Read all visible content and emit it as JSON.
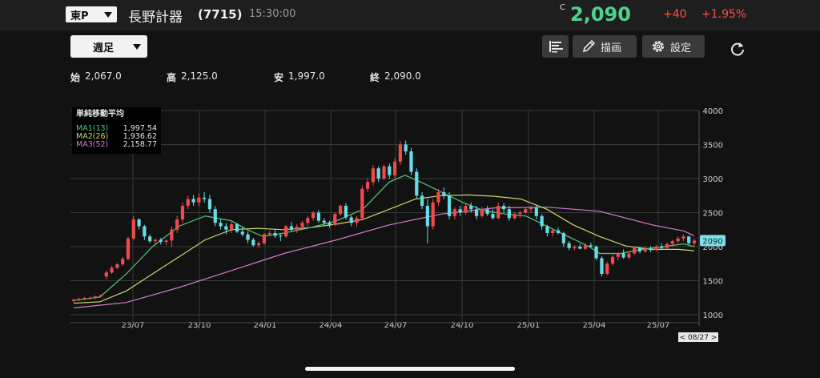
{
  "header": {
    "market": "東P",
    "name": "長野計器",
    "code": "(7715)",
    "time": "15:30:00",
    "close_mark": "C",
    "price": "2,090",
    "change": "+40",
    "change_pct": "+1.95%"
  },
  "toolbar": {
    "period": "週足",
    "draw_label": "描画",
    "settings_label": "設定"
  },
  "ohlc": {
    "open_label": "始",
    "open": "2,067.0",
    "high_label": "高",
    "high": "2,125.0",
    "low_label": "安",
    "low": "1,997.0",
    "close_label": "終",
    "close": "2,090.0"
  },
  "colors": {
    "up": "#f04b4b",
    "down": "#66dde6",
    "ma1": "#4ec97f",
    "ma2": "#c9d86a",
    "ma3": "#d77ad0",
    "price_up_text": "#4fd38a",
    "change_text": "#ff4d4d"
  },
  "chart_data": {
    "type": "candlestick",
    "legend_title": "単純移動平均",
    "legend": [
      {
        "name": "MA1(13)",
        "value": "1,997.54",
        "color": "#4ec97f"
      },
      {
        "name": "MA2(26)",
        "value": "1,936.62",
        "color": "#c9d86a"
      },
      {
        "name": "MA3(52)",
        "value": "2,158.77",
        "color": "#d77ad0"
      }
    ],
    "legend_placement": "top-left",
    "y_ticks": [
      1000,
      1500,
      2000,
      2500,
      3000,
      3500,
      4000
    ],
    "ylim": [
      900,
      4000
    ],
    "x_ticks": [
      "23/07",
      "23/10",
      "24/01",
      "24/04",
      "24/07",
      "24/10",
      "25/01",
      "25/04",
      "25/07"
    ],
    "grid": true,
    "last_price_label": "2090",
    "cursor_label": "< 08/27 >",
    "candles": [
      [
        1200,
        1240,
        1180,
        1220
      ],
      [
        1220,
        1250,
        1200,
        1235
      ],
      [
        1235,
        1260,
        1210,
        1245
      ],
      [
        1245,
        1270,
        1220,
        1250
      ],
      [
        1250,
        1280,
        1230,
        1270
      ],
      [
        1270,
        1300,
        1250,
        1285
      ],
      [
        1560,
        1650,
        1520,
        1620
      ],
      [
        1620,
        1720,
        1600,
        1690
      ],
      [
        1690,
        1760,
        1670,
        1740
      ],
      [
        1740,
        1850,
        1720,
        1820
      ],
      [
        1820,
        2150,
        1800,
        2120
      ],
      [
        2120,
        2450,
        2100,
        2400
      ],
      [
        2400,
        2420,
        2250,
        2300
      ],
      [
        2300,
        2320,
        2100,
        2150
      ],
      [
        2150,
        2180,
        2050,
        2080
      ],
      [
        2080,
        2120,
        2020,
        2100
      ],
      [
        2100,
        2130,
        2030,
        2070
      ],
      [
        2070,
        2110,
        2020,
        2090
      ],
      [
        2090,
        2300,
        2000,
        2250
      ],
      [
        2250,
        2450,
        2200,
        2400
      ],
      [
        2400,
        2650,
        2350,
        2600
      ],
      [
        2600,
        2750,
        2550,
        2700
      ],
      [
        2700,
        2760,
        2600,
        2650
      ],
      [
        2650,
        2780,
        2600,
        2720
      ],
      [
        2720,
        2800,
        2650,
        2700
      ],
      [
        2700,
        2760,
        2500,
        2550
      ],
      [
        2550,
        2600,
        2300,
        2350
      ],
      [
        2350,
        2400,
        2250,
        2300
      ],
      [
        2300,
        2350,
        2180,
        2250
      ],
      [
        2250,
        2380,
        2200,
        2330
      ],
      [
        2330,
        2350,
        2200,
        2220
      ],
      [
        2220,
        2280,
        2150,
        2180
      ],
      [
        2180,
        2220,
        2050,
        2100
      ],
      [
        2100,
        2130,
        2000,
        2020
      ],
      [
        2020,
        2080,
        1980,
        2050
      ],
      [
        2050,
        2200,
        2030,
        2180
      ],
      [
        2180,
        2230,
        2150,
        2200
      ],
      [
        2200,
        2250,
        2130,
        2160
      ],
      [
        2160,
        2200,
        2080,
        2150
      ],
      [
        2150,
        2320,
        2130,
        2300
      ],
      [
        2300,
        2360,
        2220,
        2250
      ],
      [
        2250,
        2330,
        2200,
        2290
      ],
      [
        2290,
        2380,
        2250,
        2350
      ],
      [
        2350,
        2450,
        2300,
        2420
      ],
      [
        2420,
        2520,
        2380,
        2500
      ],
      [
        2500,
        2540,
        2350,
        2380
      ],
      [
        2380,
        2420,
        2300,
        2350
      ],
      [
        2350,
        2380,
        2280,
        2320
      ],
      [
        2320,
        2500,
        2300,
        2480
      ],
      [
        2480,
        2620,
        2450,
        2600
      ],
      [
        2600,
        2640,
        2400,
        2430
      ],
      [
        2430,
        2460,
        2300,
        2350
      ],
      [
        2350,
        2450,
        2300,
        2420
      ],
      [
        2420,
        2900,
        2400,
        2850
      ],
      [
        2850,
        3000,
        2800,
        2950
      ],
      [
        2950,
        3200,
        2900,
        3150
      ],
      [
        3150,
        3180,
        2950,
        3000
      ],
      [
        3000,
        3200,
        2980,
        3180
      ],
      [
        3180,
        3220,
        3000,
        3050
      ],
      [
        3050,
        3300,
        3000,
        3250
      ],
      [
        3250,
        3550,
        3200,
        3500
      ],
      [
        3500,
        3560,
        3350,
        3400
      ],
      [
        3400,
        3450,
        3050,
        3100
      ],
      [
        3100,
        3150,
        2700,
        2750
      ],
      [
        2750,
        2800,
        2550,
        2600
      ],
      [
        2600,
        2700,
        2050,
        2300
      ],
      [
        2300,
        2700,
        2250,
        2650
      ],
      [
        2650,
        2850,
        2600,
        2800
      ],
      [
        2800,
        2870,
        2700,
        2750
      ],
      [
        2750,
        2800,
        2400,
        2450
      ],
      [
        2450,
        2580,
        2400,
        2550
      ],
      [
        2550,
        2600,
        2450,
        2500
      ],
      [
        2500,
        2640,
        2470,
        2600
      ],
      [
        2600,
        2650,
        2500,
        2550
      ],
      [
        2550,
        2600,
        2400,
        2450
      ],
      [
        2450,
        2580,
        2430,
        2550
      ],
      [
        2550,
        2600,
        2450,
        2480
      ],
      [
        2480,
        2550,
        2400,
        2420
      ],
      [
        2420,
        2650,
        2400,
        2600
      ],
      [
        2600,
        2640,
        2500,
        2550
      ],
      [
        2550,
        2600,
        2380,
        2420
      ],
      [
        2420,
        2500,
        2400,
        2480
      ],
      [
        2480,
        2530,
        2420,
        2500
      ],
      [
        2500,
        2580,
        2480,
        2550
      ],
      [
        2550,
        2600,
        2500,
        2570
      ],
      [
        2570,
        2620,
        2400,
        2450
      ],
      [
        2450,
        2480,
        2250,
        2300
      ],
      [
        2300,
        2320,
        2150,
        2200
      ],
      [
        2200,
        2260,
        2150,
        2240
      ],
      [
        2240,
        2280,
        2180,
        2200
      ],
      [
        2200,
        2220,
        2000,
        2050
      ],
      [
        2050,
        2080,
        1950,
        1980
      ],
      [
        1980,
        2020,
        1950,
        2000
      ],
      [
        2000,
        2040,
        1960,
        1970
      ],
      [
        1970,
        2050,
        1950,
        2020
      ],
      [
        2020,
        2060,
        1980,
        2000
      ],
      [
        2000,
        2020,
        1800,
        1830
      ],
      [
        1830,
        1860,
        1560,
        1600
      ],
      [
        1600,
        1780,
        1580,
        1750
      ],
      [
        1750,
        1880,
        1720,
        1850
      ],
      [
        1850,
        1920,
        1800,
        1900
      ],
      [
        1900,
        1960,
        1820,
        1840
      ],
      [
        1840,
        1920,
        1810,
        1900
      ],
      [
        1900,
        2000,
        1880,
        1980
      ],
      [
        1980,
        2000,
        1900,
        1930
      ],
      [
        1930,
        2000,
        1910,
        1970
      ],
      [
        1970,
        2010,
        1920,
        1950
      ],
      [
        1950,
        2020,
        1930,
        2000
      ],
      [
        2000,
        2050,
        1950,
        1980
      ],
      [
        1980,
        2060,
        1960,
        2040
      ],
      [
        2040,
        2100,
        2000,
        2080
      ],
      [
        2080,
        2150,
        2050,
        2120
      ],
      [
        2120,
        2180,
        2080,
        2150
      ],
      [
        2150,
        2160,
        2030,
        2050
      ],
      [
        2050,
        2120,
        2000,
        2090
      ]
    ],
    "ma1": [
      [
        0,
        1210
      ],
      [
        5,
        1260
      ],
      [
        10,
        1600
      ],
      [
        15,
        2000
      ],
      [
        20,
        2300
      ],
      [
        25,
        2450
      ],
      [
        30,
        2380
      ],
      [
        33,
        2250
      ],
      [
        36,
        2150
      ],
      [
        40,
        2200
      ],
      [
        45,
        2280
      ],
      [
        50,
        2380
      ],
      [
        55,
        2550
      ],
      [
        60,
        2950
      ],
      [
        63,
        3050
      ],
      [
        66,
        2950
      ],
      [
        70,
        2800
      ],
      [
        74,
        2650
      ],
      [
        78,
        2530
      ],
      [
        82,
        2480
      ],
      [
        86,
        2450
      ],
      [
        90,
        2300
      ],
      [
        94,
        2150
      ],
      [
        98,
        2000
      ],
      [
        100,
        1900
      ],
      [
        104,
        1900
      ],
      [
        108,
        1960
      ],
      [
        112,
        2000
      ],
      [
        116,
        2040
      ],
      [
        118,
        2000
      ]
    ],
    "ma2": [
      [
        0,
        1170
      ],
      [
        5,
        1190
      ],
      [
        10,
        1350
      ],
      [
        15,
        1600
      ],
      [
        20,
        1850
      ],
      [
        25,
        2100
      ],
      [
        30,
        2250
      ],
      [
        35,
        2270
      ],
      [
        40,
        2250
      ],
      [
        45,
        2280
      ],
      [
        50,
        2330
      ],
      [
        55,
        2400
      ],
      [
        60,
        2550
      ],
      [
        65,
        2700
      ],
      [
        70,
        2750
      ],
      [
        75,
        2760
      ],
      [
        80,
        2740
      ],
      [
        85,
        2700
      ],
      [
        90,
        2550
      ],
      [
        95,
        2320
      ],
      [
        100,
        2150
      ],
      [
        105,
        2010
      ],
      [
        110,
        1960
      ],
      [
        115,
        1960
      ],
      [
        118,
        1940
      ]
    ],
    "ma3": [
      [
        0,
        1100
      ],
      [
        10,
        1180
      ],
      [
        20,
        1400
      ],
      [
        30,
        1650
      ],
      [
        40,
        1900
      ],
      [
        50,
        2100
      ],
      [
        60,
        2320
      ],
      [
        70,
        2480
      ],
      [
        80,
        2570
      ],
      [
        90,
        2580
      ],
      [
        100,
        2520
      ],
      [
        110,
        2320
      ],
      [
        116,
        2230
      ],
      [
        118,
        2160
      ]
    ]
  }
}
